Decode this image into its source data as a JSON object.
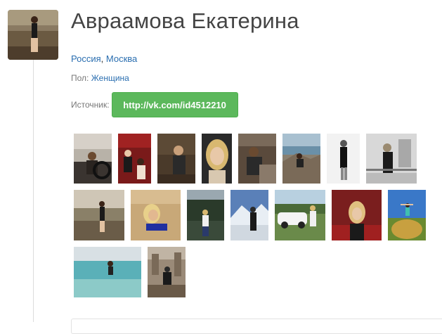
{
  "profile": {
    "name": "Авраамова Екатерина",
    "country": "Россия",
    "separator": ", ",
    "city": "Москва",
    "gender_label": "Пол: ",
    "gender_value": "Женщина",
    "source_label": "Источник:",
    "source_url": "http://vk.com/id4512210"
  },
  "colors": {
    "link": "#2a6eb0",
    "button": "#5cb85c"
  },
  "photos": [
    "photo-car",
    "photo-red-interior",
    "photo-dark-room",
    "photo-blonde-portrait",
    "photo-restaurant",
    "photo-rocks",
    "photo-black-dress",
    "photo-balcony",
    "photo-sea",
    "photo-beach-sand",
    "photo-trees",
    "photo-mountains",
    "photo-white-car",
    "photo-party",
    "photo-hay-bale",
    "photo-sea-wide",
    "photo-ruins"
  ]
}
